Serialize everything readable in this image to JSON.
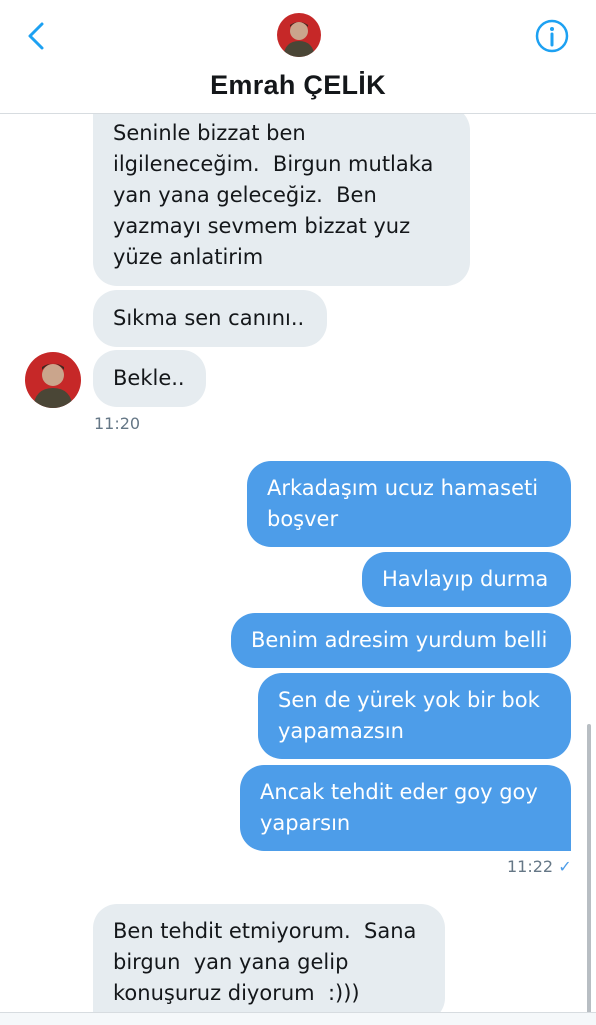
{
  "header": {
    "title": "Emrah ÇELİK",
    "back_icon": "chevron-left-icon",
    "info_icon": "info-icon",
    "accent": "#1da1f2"
  },
  "messages": [
    {
      "from": "them",
      "text": "Seninle bizzat ben\nilgileneceğim.  Birgun mutlaka\nyan yana geleceğiz.  Ben\nyazmayı sevmem bizzat yuz\nyüze anlatirim"
    },
    {
      "from": "them",
      "text": "Sıkma sen canını.."
    },
    {
      "from": "them",
      "text": "Bekle.."
    },
    {
      "from": "me",
      "text": "Arkadaşım ucuz hamaseti\nboşver"
    },
    {
      "from": "me",
      "text": "Havlayıp durma"
    },
    {
      "from": "me",
      "text": "Benim adresim yurdum belli"
    },
    {
      "from": "me",
      "text": "Sen de yürek yok bir bok\nyapamazsın"
    },
    {
      "from": "me",
      "text": "Ancak tehdit eder goy goy\nyaparsın"
    },
    {
      "from": "them",
      "text": "Ben tehdit etmiyorum.  Sana\nbirgun  yan yana gelip\nkonuşuruz diyorum  :)))"
    }
  ],
  "timestamps": {
    "received": "11:20",
    "sent": "11:22",
    "sent_status": "✓"
  },
  "colors": {
    "sent_bubble": "#4d9de9",
    "received_bubble": "#e6ecf0"
  }
}
